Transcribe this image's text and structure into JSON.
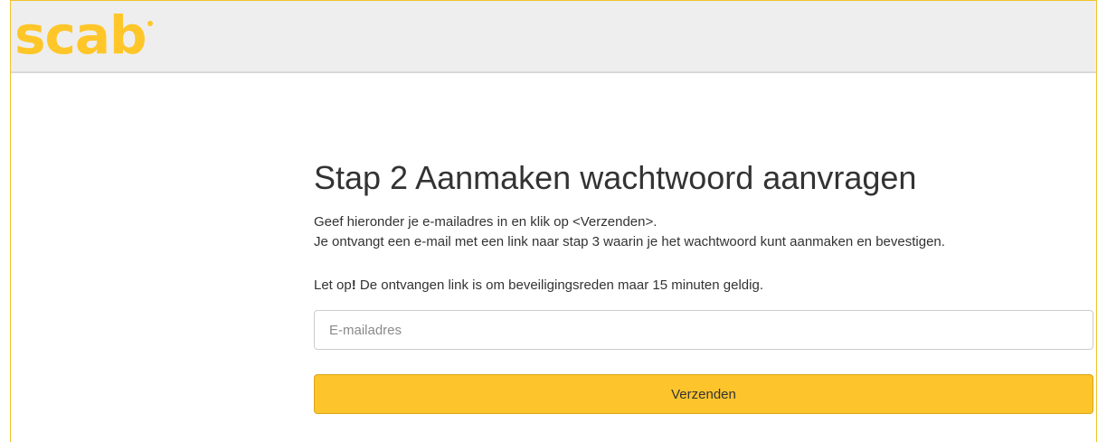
{
  "header": {
    "logo_text": "scab",
    "brand_color": "#ffc629"
  },
  "main": {
    "title": "Stap 2 Aanmaken wachtwoord aanvragen",
    "instruction_line1": "Geef hieronder je e-mailadres in en klik op <Verzenden>.",
    "instruction_line2": "Je ontvangt een e-mail met een link naar stap 3 waarin je het wachtwoord kunt aanmaken en bevestigen.",
    "note_prefix": "Let op",
    "note_exclaim": "!",
    "note_text": " De ontvangen link is om beveiligingsreden maar 15 minuten geldig.",
    "email_value": "",
    "email_placeholder": "E-mailadres",
    "submit_label": "Verzenden",
    "button_color": "#fec42c"
  }
}
